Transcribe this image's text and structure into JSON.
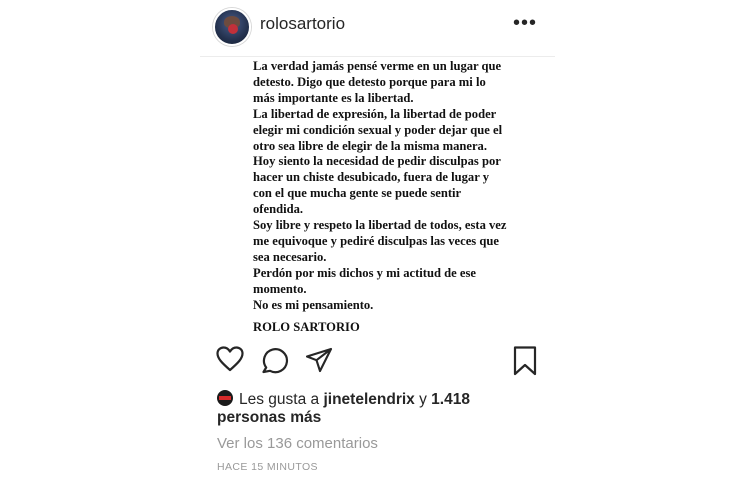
{
  "header": {
    "username": "rolosartorio",
    "more_icon": "•••"
  },
  "post": {
    "statement_lines": [
      "La verdad jamás pensé verme en un lugar que",
      "detesto. Digo que detesto porque para mi lo",
      "más importante es la libertad.",
      "La libertad de expresión, la libertad de poder",
      "elegir mi condición sexual y poder dejar que el",
      "otro sea libre de elegir de la misma manera.",
      "Hoy siento la necesidad de pedir disculpas por",
      "hacer un chiste desubicado, fuera de lugar y",
      "con el que mucha gente se puede sentir",
      "ofendida.",
      "Soy libre y respeto la libertad de todos, esta vez",
      "me equivoque y pediré disculpas las veces que",
      "sea necesario.",
      "Perdón por mis dichos y mi actitud de ese",
      "momento.",
      "No es mi pensamiento."
    ],
    "signature": "ROLO SARTORIO"
  },
  "actions": {
    "icons": [
      "heart-icon",
      "comment-icon",
      "share-icon",
      "bookmark-icon"
    ]
  },
  "likes": {
    "prefix": "Les gusta a",
    "user": "jinetelendrix",
    "conjunction": "y",
    "count": "1.418",
    "suffix": "personas más"
  },
  "comments": {
    "label": "Ver los 136 comentarios"
  },
  "timestamp": "HACE 15 MINUTOS",
  "colors": {
    "text": "#262626",
    "muted": "#999999",
    "divider": "#ececec"
  }
}
